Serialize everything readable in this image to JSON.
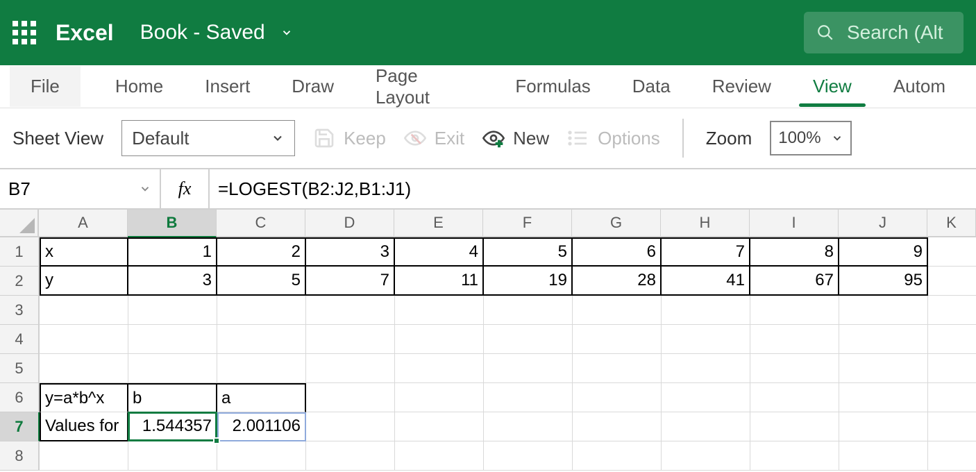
{
  "app": {
    "name": "Excel",
    "doc_status": "Book  -  Saved"
  },
  "search": {
    "placeholder": "Search (Alt"
  },
  "tabs": [
    "File",
    "Home",
    "Insert",
    "Draw",
    "Page Layout",
    "Formulas",
    "Data",
    "Review",
    "View",
    "Autom"
  ],
  "active_tab": "View",
  "ribbon": {
    "sheet_view_label": "Sheet View",
    "sheet_view_value": "Default",
    "keep": "Keep",
    "exit": "Exit",
    "new": "New",
    "options": "Options",
    "zoom_label": "Zoom",
    "zoom_value": "100%"
  },
  "namebox": "B7",
  "fx_label": "fx",
  "formula": "=LOGEST(B2:J2,B1:J1)",
  "columns": [
    "A",
    "B",
    "C",
    "D",
    "E",
    "F",
    "G",
    "H",
    "I",
    "J",
    "K"
  ],
  "row_nums": [
    "1",
    "2",
    "3",
    "4",
    "5",
    "6",
    "7",
    "8"
  ],
  "cells": {
    "A1": "x",
    "B1": "1",
    "C1": "2",
    "D1": "3",
    "E1": "4",
    "F1": "5",
    "G1": "6",
    "H1": "7",
    "I1": "8",
    "J1": "9",
    "A2": "y",
    "B2": "3",
    "C2": "5",
    "D2": "7",
    "E2": "11",
    "F2": "19",
    "G2": "28",
    "H2": "41",
    "I2": "67",
    "J2": "95",
    "A6": "y=a*b^x",
    "B6": "b",
    "C6": "a",
    "A7": "Values for",
    "B7": "1.544357",
    "C7": "2.001106"
  }
}
